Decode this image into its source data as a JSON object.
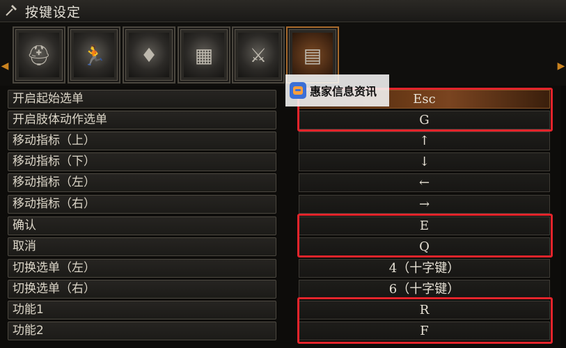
{
  "window": {
    "title": "按键设定",
    "title_icon": "hammer-icon"
  },
  "tabs": [
    {
      "name": "helmet-icon",
      "glyph": "⛑",
      "active": false
    },
    {
      "name": "running-figure-icon",
      "glyph": "🏃",
      "active": false
    },
    {
      "name": "glowing-figure-icon",
      "glyph": "♦",
      "active": false
    },
    {
      "name": "panels-icon",
      "glyph": "▦",
      "active": false
    },
    {
      "name": "knight-icon",
      "glyph": "⚔",
      "active": false
    },
    {
      "name": "controller-settings-icon",
      "glyph": "▤",
      "active": true
    }
  ],
  "bindings": [
    {
      "action": "开启起始选单",
      "key": "Esc"
    },
    {
      "action": "开启肢体动作选单",
      "key": "G"
    },
    {
      "action": "移动指标（上）",
      "key": "↑"
    },
    {
      "action": "移动指标（下）",
      "key": "↓"
    },
    {
      "action": "移动指标（左）",
      "key": "←"
    },
    {
      "action": "移动指标（右）",
      "key": "→"
    },
    {
      "action": "确认",
      "key": "E"
    },
    {
      "action": "取消",
      "key": "Q"
    },
    {
      "action": "切换选单（左）",
      "key": "4（十字键）"
    },
    {
      "action": "切换选单（右）",
      "key": "6（十字键）"
    },
    {
      "action": "功能1",
      "key": "R"
    },
    {
      "action": "功能2",
      "key": "F"
    }
  ],
  "selected_index": 0,
  "watermark": {
    "text": "惠家信息资讯",
    "icon": "robot-logo-icon"
  },
  "colors": {
    "accent_orange": "#c9821f",
    "highlight_red": "#e3242b",
    "panel_bg": "#0d0c0a"
  }
}
